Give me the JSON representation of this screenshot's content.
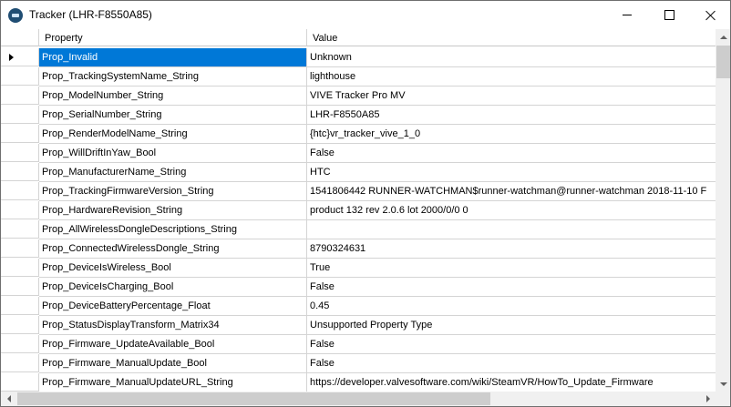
{
  "window": {
    "title": "Tracker (LHR-F8550A85)",
    "icon": "tracker-app-icon",
    "controls": [
      "minimize-icon",
      "maximize-icon",
      "close-icon"
    ]
  },
  "table": {
    "columns": {
      "property": "Property",
      "value": "Value"
    },
    "selected_row_index": 0,
    "selection_color": "#0078d7",
    "rows": [
      {
        "property": "Prop_Invalid",
        "value": "Unknown"
      },
      {
        "property": "Prop_TrackingSystemName_String",
        "value": "lighthouse"
      },
      {
        "property": "Prop_ModelNumber_String",
        "value": "VIVE Tracker Pro MV"
      },
      {
        "property": "Prop_SerialNumber_String",
        "value": "LHR-F8550A85"
      },
      {
        "property": "Prop_RenderModelName_String",
        "value": "{htc}vr_tracker_vive_1_0"
      },
      {
        "property": "Prop_WillDriftInYaw_Bool",
        "value": "False"
      },
      {
        "property": "Prop_ManufacturerName_String",
        "value": "HTC"
      },
      {
        "property": "Prop_TrackingFirmwareVersion_String",
        "value": "1541806442 RUNNER-WATCHMAN$runner-watchman@runner-watchman 2018-11-10 F"
      },
      {
        "property": "Prop_HardwareRevision_String",
        "value": "product 132 rev 2.0.6 lot 2000/0/0 0"
      },
      {
        "property": "Prop_AllWirelessDongleDescriptions_String",
        "value": ""
      },
      {
        "property": "Prop_ConnectedWirelessDongle_String",
        "value": "8790324631"
      },
      {
        "property": "Prop_DeviceIsWireless_Bool",
        "value": "True"
      },
      {
        "property": "Prop_DeviceIsCharging_Bool",
        "value": "False"
      },
      {
        "property": "Prop_DeviceBatteryPercentage_Float",
        "value": "0.45"
      },
      {
        "property": "Prop_StatusDisplayTransform_Matrix34",
        "value": "Unsupported Property Type"
      },
      {
        "property": "Prop_Firmware_UpdateAvailable_Bool",
        "value": "False"
      },
      {
        "property": "Prop_Firmware_ManualUpdate_Bool",
        "value": "False"
      },
      {
        "property": "Prop_Firmware_ManualUpdateURL_String",
        "value": "https://developer.valvesoftware.com/wiki/SteamVR/HowTo_Update_Firmware"
      }
    ]
  }
}
